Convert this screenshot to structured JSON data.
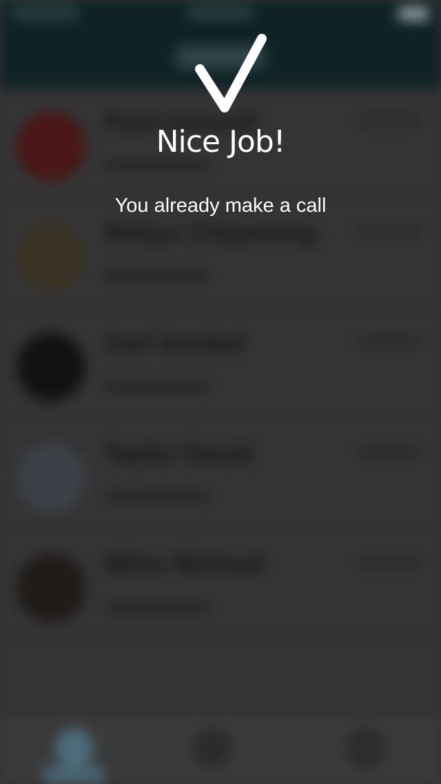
{
  "overlay": {
    "title": "Nice Job!",
    "message": "You already make a call",
    "icon": "checkmark-icon"
  },
  "colors": {
    "header_background": "#0f2226",
    "screen_background": "#343434",
    "overlay_text": "#ffffff"
  },
  "background_app": {
    "contacts": [
      {
        "name": "Pam Ironwell",
        "avatar_color": "#4a1616"
      },
      {
        "name": "Robyn Chipeming",
        "avatar_color": "#3a3324"
      },
      {
        "name": "Carl Goebel",
        "avatar_color": "#121212"
      },
      {
        "name": "Taylor David",
        "avatar_color": "#3b4147"
      },
      {
        "name": "Miles Michael",
        "avatar_color": "#1f1c18"
      }
    ]
  }
}
